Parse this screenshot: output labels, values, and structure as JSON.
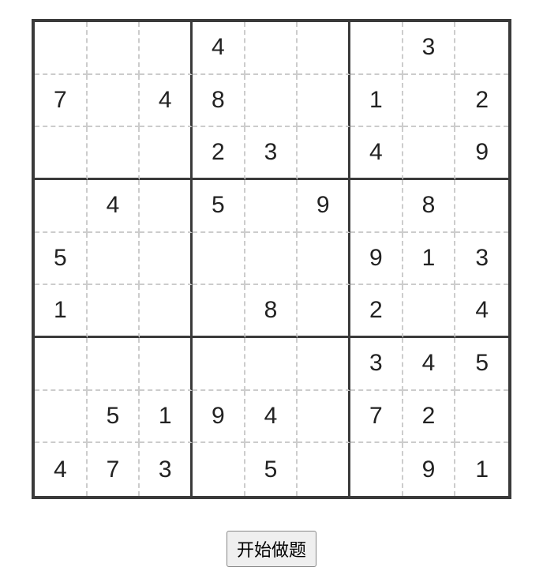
{
  "sudoku": {
    "grid": [
      [
        "",
        "",
        "",
        "4",
        "",
        "",
        "",
        "3",
        ""
      ],
      [
        "7",
        "",
        "4",
        "8",
        "",
        "",
        "1",
        "",
        "2"
      ],
      [
        "",
        "",
        "",
        "2",
        "3",
        "",
        "4",
        "",
        "9"
      ],
      [
        "",
        "4",
        "",
        "5",
        "",
        "9",
        "",
        "8",
        ""
      ],
      [
        "5",
        "",
        "",
        "",
        "",
        "",
        "9",
        "1",
        "3"
      ],
      [
        "1",
        "",
        "",
        "",
        "8",
        "",
        "2",
        "",
        "4"
      ],
      [
        "",
        "",
        "",
        "",
        "",
        "",
        "3",
        "4",
        "5"
      ],
      [
        "",
        "5",
        "1",
        "9",
        "4",
        "",
        "7",
        "2",
        ""
      ],
      [
        "4",
        "7",
        "3",
        "",
        "5",
        "",
        "",
        "9",
        "1"
      ]
    ]
  },
  "controls": {
    "start_label": "开始做题"
  }
}
